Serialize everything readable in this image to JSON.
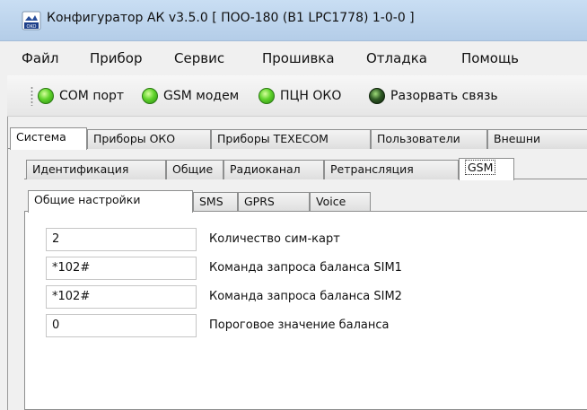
{
  "window": {
    "title": "Конфигуратор АК v3.5.0 [ ПОО-180 (B1 LPC1778) 1-0-0 ]",
    "icon": "oko-app-icon"
  },
  "menu": [
    "Файл",
    "Прибор",
    "Сервис",
    "Прошивка",
    "Отладка",
    "Помощь"
  ],
  "toolbar": {
    "buttons": [
      {
        "label": "COM порт",
        "icon": "green-led-icon",
        "color": "#4cc026"
      },
      {
        "label": "GSM модем",
        "icon": "green-led-icon",
        "color": "#4cc026"
      },
      {
        "label": "ПЦН ОКО",
        "icon": "green-led-icon",
        "color": "#4cc026"
      },
      {
        "label": "Разорвать связь",
        "icon": "dark-green-led-icon",
        "color": "#1c3a16"
      }
    ]
  },
  "tabs_main": [
    "Система",
    "Приборы ОКО",
    "Приборы TEXECOM",
    "Пользователи",
    "Внешни"
  ],
  "tabs_main_active": "Система",
  "tabs_sub": [
    "Идентификация",
    "Общие",
    "Радиоканал",
    "Ретрансляция",
    "GSM"
  ],
  "tabs_sub_active": "GSM",
  "tabs_gsm": [
    "Общие настройки",
    "SMS",
    "GPRS",
    "Voice"
  ],
  "tabs_gsm_active": "Общие настройки",
  "settings": [
    {
      "value": "2",
      "label": "Количество сим-карт"
    },
    {
      "value": "*102#",
      "label": "Команда запроса баланса SIM1"
    },
    {
      "value": "*102#",
      "label": "Команда запроса баланса SIM2"
    },
    {
      "value": "0",
      "label": "Пороговое значение баланса"
    }
  ]
}
